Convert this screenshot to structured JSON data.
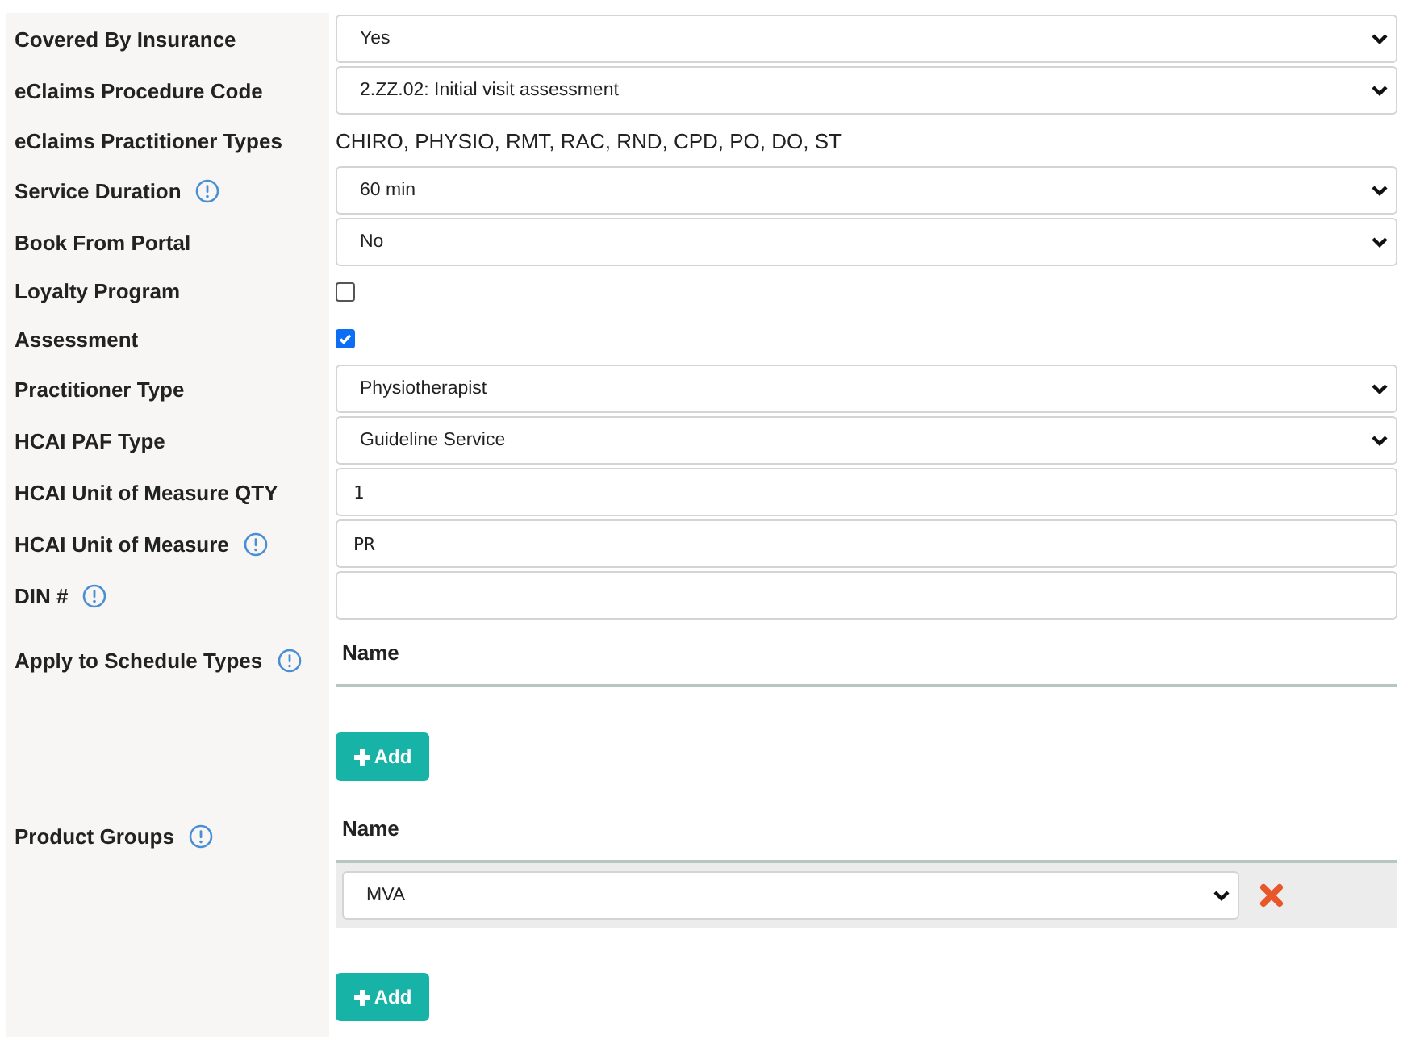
{
  "fields": [
    {
      "label": "Covered By Insurance",
      "info": false,
      "kind": "select",
      "value": "Yes"
    },
    {
      "label": "eClaims Procedure Code",
      "info": false,
      "kind": "select",
      "value": "2.ZZ.02: Initial visit assessment"
    },
    {
      "label": "eClaims Practitioner Types",
      "info": false,
      "kind": "text",
      "value": "CHIRO, PHYSIO, RMT, RAC, RND, CPD, PO, DO, ST"
    },
    {
      "label": "Service Duration",
      "info": true,
      "kind": "select",
      "value": "60 min"
    },
    {
      "label": "Book From Portal",
      "info": false,
      "kind": "select",
      "value": "No"
    },
    {
      "label": "Loyalty Program",
      "info": false,
      "kind": "checkbox",
      "checked": false
    },
    {
      "label": "Assessment",
      "info": false,
      "kind": "checkbox",
      "checked": true
    },
    {
      "label": "Practitioner Type",
      "info": false,
      "kind": "select",
      "value": "Physiotherapist"
    },
    {
      "label": "HCAI PAF Type",
      "info": false,
      "kind": "select",
      "value": "Guideline Service"
    },
    {
      "label": "HCAI Unit of Measure QTY",
      "info": false,
      "kind": "input",
      "value": "1"
    },
    {
      "label": "HCAI Unit of Measure",
      "info": true,
      "kind": "input",
      "value": "PR"
    },
    {
      "label": "DIN #",
      "info": true,
      "kind": "input"
    },
    {
      "label": "Apply to Schedule Types",
      "info": true,
      "kind": "table",
      "column": "Name",
      "add_button": "Add"
    },
    {
      "label": "Product Groups",
      "info": true,
      "kind": "table",
      "column": "Name",
      "rows": [
        {
          "value": "MVA"
        }
      ],
      "add_button": "Add"
    }
  ]
}
